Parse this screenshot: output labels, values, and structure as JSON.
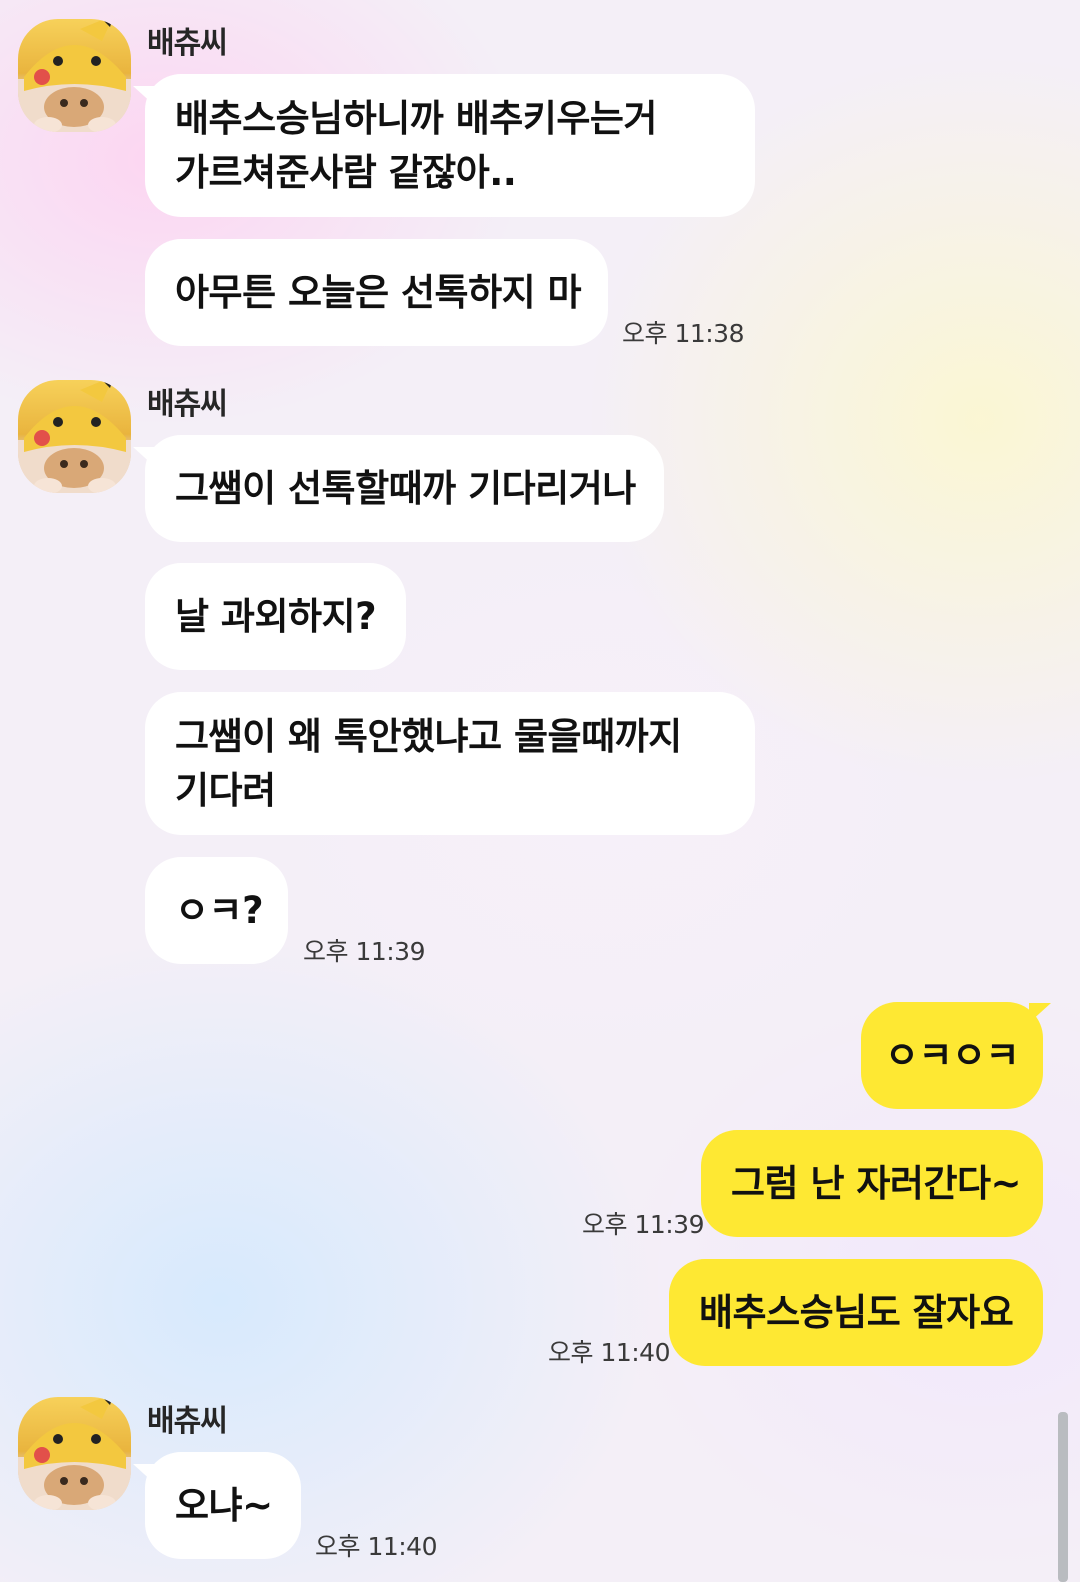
{
  "chat": {
    "sender_name": "배츄씨",
    "messages": [
      {
        "side": "left",
        "lines": [
          "배추스승님하니까 배추키우는거",
          "가르쳐준사람 같잖아.."
        ]
      },
      {
        "side": "left",
        "text": "아무튼 오늘은 선톡하지 마",
        "time": "오후 11:38"
      },
      {
        "side": "left",
        "text": "그쌤이 선톡할때까 기다리거나"
      },
      {
        "side": "left",
        "text": "날 과외하지?"
      },
      {
        "side": "left",
        "lines": [
          "그쌤이 왜 톡안했냐고 물을때까지",
          "기다려"
        ]
      },
      {
        "side": "left",
        "text": "ㅇㅋ?",
        "time": "오후 11:39"
      },
      {
        "side": "right",
        "text": "ㅇㅋㅇㅋ"
      },
      {
        "side": "right",
        "text": "그럼 난 자러간다~",
        "time": "오후 11:39"
      },
      {
        "side": "right",
        "text": "배추스승님도 잘자요",
        "time": "오후 11:40"
      },
      {
        "side": "left",
        "text": "오냐~",
        "time": "오후 11:40"
      }
    ]
  },
  "avatar_icon": "pikachu-hat-cat-avatar",
  "colors": {
    "my_bubble": "#fee833",
    "their_bubble": "#ffffff"
  }
}
